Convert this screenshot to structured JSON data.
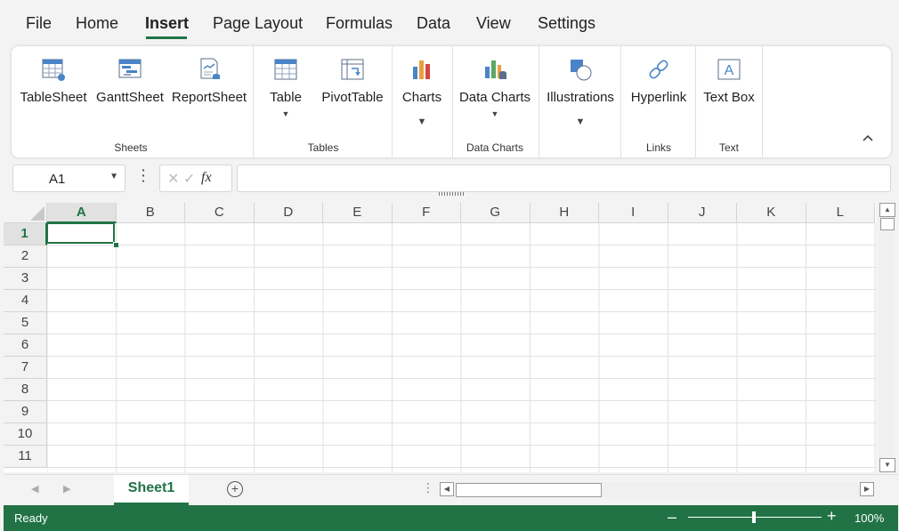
{
  "menu": {
    "items": [
      "File",
      "Home",
      "Insert",
      "Page Layout",
      "Formulas",
      "Data",
      "View",
      "Settings"
    ],
    "active": "Insert"
  },
  "ribbon": {
    "buttons": {
      "tablesheet": "TableSheet",
      "ganttsheet": "GanttSheet",
      "reportsheet": "ReportSheet",
      "table": "Table",
      "pivottable": "PivotTable",
      "charts": "Charts",
      "datacharts": "Data Charts",
      "illustrations": "Illustrations",
      "hyperlink": "Hyperlink",
      "textbox": "Text Box"
    },
    "groups": {
      "sheets": "Sheets",
      "tables": "Tables",
      "datacharts": "Data Charts",
      "links": "Links",
      "text": "Text"
    },
    "textbox_glyph": "A"
  },
  "formula_bar": {
    "name_box": "A1",
    "fx_label": "fx",
    "formula": ""
  },
  "grid": {
    "columns": [
      "A",
      "B",
      "C",
      "D",
      "E",
      "F",
      "G",
      "H",
      "I",
      "J",
      "K",
      "L"
    ],
    "rows": [
      "1",
      "2",
      "3",
      "4",
      "5",
      "6",
      "7",
      "8",
      "9",
      "10",
      "11"
    ],
    "selected_column": "A",
    "selected_row": "1"
  },
  "sheets": {
    "tabs": [
      "Sheet1"
    ],
    "active": "Sheet1"
  },
  "status": {
    "text": "Ready",
    "zoom": "100%"
  },
  "colors": {
    "accent": "#217346"
  }
}
